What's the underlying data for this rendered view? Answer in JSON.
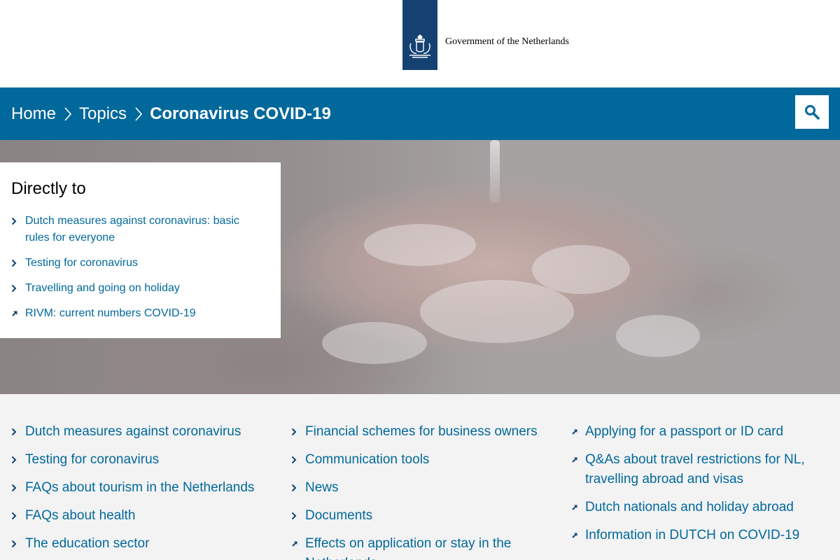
{
  "header": {
    "logo_text": "Government of the Netherlands",
    "colors": {
      "ribbon": "#154273",
      "bar": "#01689b",
      "link": "#01689b"
    }
  },
  "breadcrumb": {
    "items": [
      {
        "label": "Home"
      },
      {
        "label": "Topics"
      },
      {
        "label": "Coronavirus COVID-19"
      }
    ]
  },
  "search": {
    "icon": "search-icon"
  },
  "directly_to": {
    "title": "Directly to",
    "items": [
      {
        "label": "Dutch measures against coronavirus: basic rules for everyone",
        "icon": "chevron-right-icon"
      },
      {
        "label": "Testing for coronavirus",
        "icon": "chevron-right-icon"
      },
      {
        "label": "Travelling and going on holiday",
        "icon": "chevron-right-icon"
      },
      {
        "label": "RIVM: current numbers COVID-19",
        "icon": "external-link-icon"
      }
    ]
  },
  "links": {
    "col1": [
      {
        "label": "Dutch measures against coronavirus",
        "icon": "chevron-right-icon"
      },
      {
        "label": "Testing for coronavirus",
        "icon": "chevron-right-icon"
      },
      {
        "label": "FAQs about tourism in the Netherlands",
        "icon": "chevron-right-icon"
      },
      {
        "label": "FAQs about health",
        "icon": "chevron-right-icon"
      },
      {
        "label": "The education sector",
        "icon": "chevron-right-icon"
      }
    ],
    "col2": [
      {
        "label": "Financial schemes for business owners",
        "icon": "chevron-right-icon"
      },
      {
        "label": "Communication tools",
        "icon": "chevron-right-icon"
      },
      {
        "label": "News",
        "icon": "chevron-right-icon"
      },
      {
        "label": "Documents",
        "icon": "chevron-right-icon"
      },
      {
        "label": "Effects on application or stay in the Netherlands",
        "icon": "external-link-icon"
      }
    ],
    "col3": [
      {
        "label": "Applying for a passport or ID card",
        "icon": "external-link-icon"
      },
      {
        "label": "Q&As about travel restrictions for NL, travelling abroad and visas",
        "icon": "external-link-icon"
      },
      {
        "label": "Dutch nationals and holiday abroad",
        "icon": "external-link-icon"
      },
      {
        "label": "Information in DUTCH on COVID-19",
        "icon": "external-link-icon"
      }
    ]
  }
}
